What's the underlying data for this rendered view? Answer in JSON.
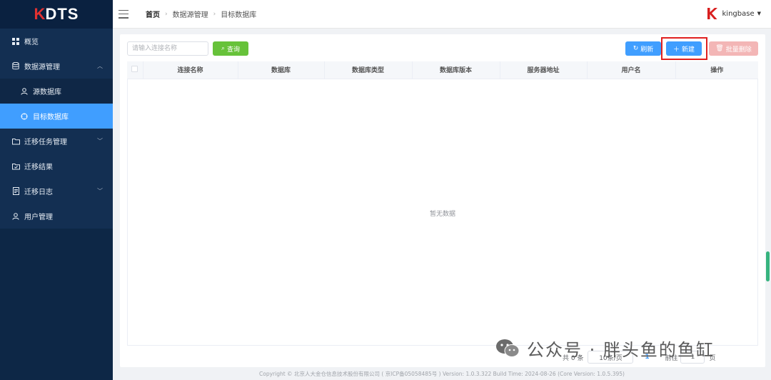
{
  "app": {
    "logo_k": "K",
    "logo_text": "DTS"
  },
  "sidebar": {
    "items": [
      {
        "label": "概览",
        "icon": "grid-icon"
      },
      {
        "label": "数据源管理",
        "icon": "database-icon",
        "expanded": true
      },
      {
        "label": "源数据库",
        "icon": "user-icon",
        "sub": true
      },
      {
        "label": "目标数据库",
        "icon": "target-icon",
        "sub": true,
        "active": true
      },
      {
        "label": "迁移任务管理",
        "icon": "folder-icon",
        "expandable": true
      },
      {
        "label": "迁移结果",
        "icon": "result-icon"
      },
      {
        "label": "迁移日志",
        "icon": "log-icon",
        "expandable": true
      },
      {
        "label": "用户管理",
        "icon": "person-icon"
      }
    ]
  },
  "header": {
    "breadcrumb": [
      "首页",
      "数据源管理",
      "目标数据库"
    ],
    "user": "kingbase"
  },
  "toolbar": {
    "search_placeholder": "请输入连接名称",
    "search_value": "",
    "query_label": "查询",
    "refresh_label": "刷新",
    "new_label": "新建",
    "batch_delete_label": "批量删除"
  },
  "table": {
    "columns": [
      "连接名称",
      "数据库",
      "数据库类型",
      "数据库版本",
      "服务器地址",
      "用户名",
      "操作"
    ],
    "empty_text": "暂无数据"
  },
  "pager": {
    "total": "共 0 条",
    "page_size": "10条/页",
    "current_page": "1",
    "goto_label": "前往",
    "goto_value": "1",
    "page_suffix": "页"
  },
  "footer": {
    "text": "Copyright © 北京人大金仓信息技术股份有限公司 ( 京ICP备05058485号 ) Version: 1.0.3.322 Build Time: 2024-08-26 (Core Version: 1.0.5.395)"
  },
  "watermark": {
    "text": "公众号 · 胖头鱼的鱼缸"
  },
  "colors": {
    "sidebar": "#0d2746",
    "active": "#409eff",
    "query": "#67c23a",
    "danger_disabled": "#f3b6b6"
  }
}
